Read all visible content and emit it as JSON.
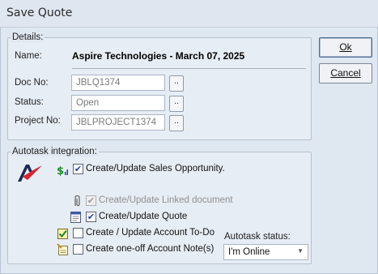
{
  "window": {
    "title": "Save Quote"
  },
  "details": {
    "legend": "Details:",
    "name_label": "Name:",
    "name_value": "Aspire Technologies - March 07, 2025",
    "doc_no_label": "Doc No:",
    "doc_no_value": "JBLQ1374",
    "status_label": "Status:",
    "status_value": "Open",
    "project_no_label": "Project No:",
    "project_no_value": "JBLPROJECT1374",
    "browse_label": ".."
  },
  "buttons": {
    "ok": "Ok",
    "cancel": "Cancel"
  },
  "autotask": {
    "legend": "Autotask integration:",
    "options": [
      {
        "label": "Create/Update Sales Opportunity.",
        "checked": true,
        "enabled": true,
        "icon": "dollar-chart-icon"
      },
      {
        "label": "Create/Update Linked document",
        "checked": true,
        "enabled": false,
        "icon": "paperclip-icon"
      },
      {
        "label": "Create/Update Quote",
        "checked": true,
        "enabled": true,
        "icon": "quote-document-icon"
      },
      {
        "label": "Create / Update Account To-Do",
        "checked": false,
        "enabled": true,
        "icon": "todo-checklist-icon"
      },
      {
        "label": "Create one-off Account Note(s)",
        "checked": false,
        "enabled": true,
        "icon": "note-pencil-icon"
      }
    ],
    "status_label": "Autotask status:",
    "status_value": "I'm Online",
    "checkmark": "✔"
  },
  "colors": {
    "accent": "#1f3fa8",
    "logo_red": "#d9232d",
    "logo_navy": "#1b2a55",
    "background": "#e1e8f1"
  }
}
